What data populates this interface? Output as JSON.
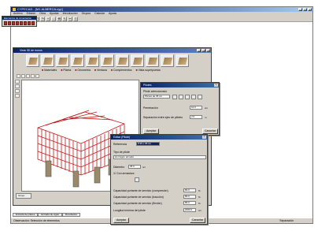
{
  "app": {
    "title": "CYPECAD - [M1 ALBERCA.cyp]",
    "window_buttons": [
      "_",
      "□",
      "×"
    ]
  },
  "menu": [
    "Archivo",
    "Edición",
    "Obra",
    "Ayudas",
    "Introducción",
    "Grupos",
    "Calcular",
    "Ayuda"
  ],
  "palette": {
    "title": "Elementos de cimentación"
  },
  "main_window": {
    "title": "Vista 3D de muros"
  },
  "sublabels": [
    "Materiales",
    "Planta",
    "Geometría",
    "Ventana",
    "Complementos",
    "Vista superpuesta"
  ],
  "dialog_top": {
    "title": "Pilotes",
    "label_1": "Pilote seleccionado",
    "label_2": "Pilotes de 35 cm",
    "label_3": "Penetración",
    "value_3": "10.0",
    "unit_3": "cm",
    "label_4": "Separación entre ejes de pilotes",
    "value_4": "2.0",
    "unit_4": "m",
    "ok": "Aceptar",
    "cancel": "Cancelar"
  },
  "dialog_bottom": {
    "title": "Editar  (Pilote)",
    "label_ref": "Referencia",
    "value_ref": "P.35 x 35 cm",
    "label_type": "Tipo de pilote",
    "value_type": "Hormigón armado",
    "label_diam": "Diámetro",
    "value_diam": "35.0",
    "unit_diam": "cm",
    "check_label": "Con armadura",
    "label_cap1": "Capacidad portante de servicio (compresión)",
    "value_cap1": "80.0",
    "unit_cap1": "%",
    "label_cap2": "Capacidad portante de servicio (tracción)",
    "value_cap2": "80.0",
    "unit_cap2": "%",
    "label_cap3": "Capacidad portante de servicio (flexión)",
    "value_cap3": "80.0",
    "unit_cap3": "%",
    "label_len": "Longitud mínima del pilote",
    "value_len": "2000.0",
    "unit_len": "cm",
    "ok": "Aceptar",
    "cancel": "Cancelar"
  },
  "tabs_bottom": [
    "Entrada de pilares",
    "Entrada de vigas",
    "Resultados"
  ],
  "status": {
    "left": "Observación: Selección de elementos",
    "right": "Separación"
  },
  "group_button": "Grupo"
}
